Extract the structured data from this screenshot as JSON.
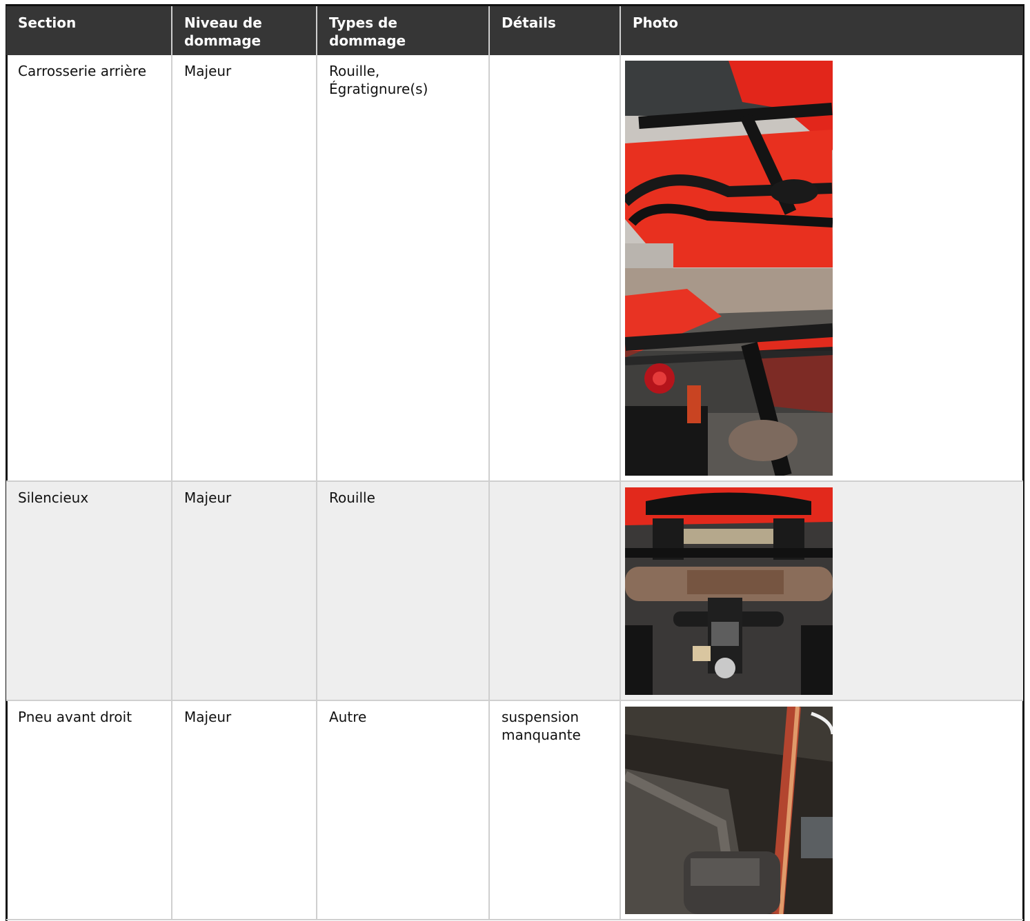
{
  "table": {
    "headers": [
      "Section",
      "Niveau de dommage",
      "Types de dommage",
      "Détails",
      "Photo"
    ],
    "rows": [
      {
        "section": "Carrosserie arrière",
        "niveau": "Majeur",
        "types": "Rouille, Égratignure(s)",
        "details": "",
        "photos": [
          "photo-rear-rack",
          "photo-rear-taillight"
        ]
      },
      {
        "section": "Silencieux",
        "niveau": "Majeur",
        "types": "Rouille",
        "details": "",
        "photos": [
          "photo-muffler"
        ]
      },
      {
        "section": "Pneu avant droit",
        "niveau": "Majeur",
        "types": "Autre",
        "details": "suspension manquante",
        "photos": [
          "photo-front-right"
        ]
      }
    ]
  }
}
